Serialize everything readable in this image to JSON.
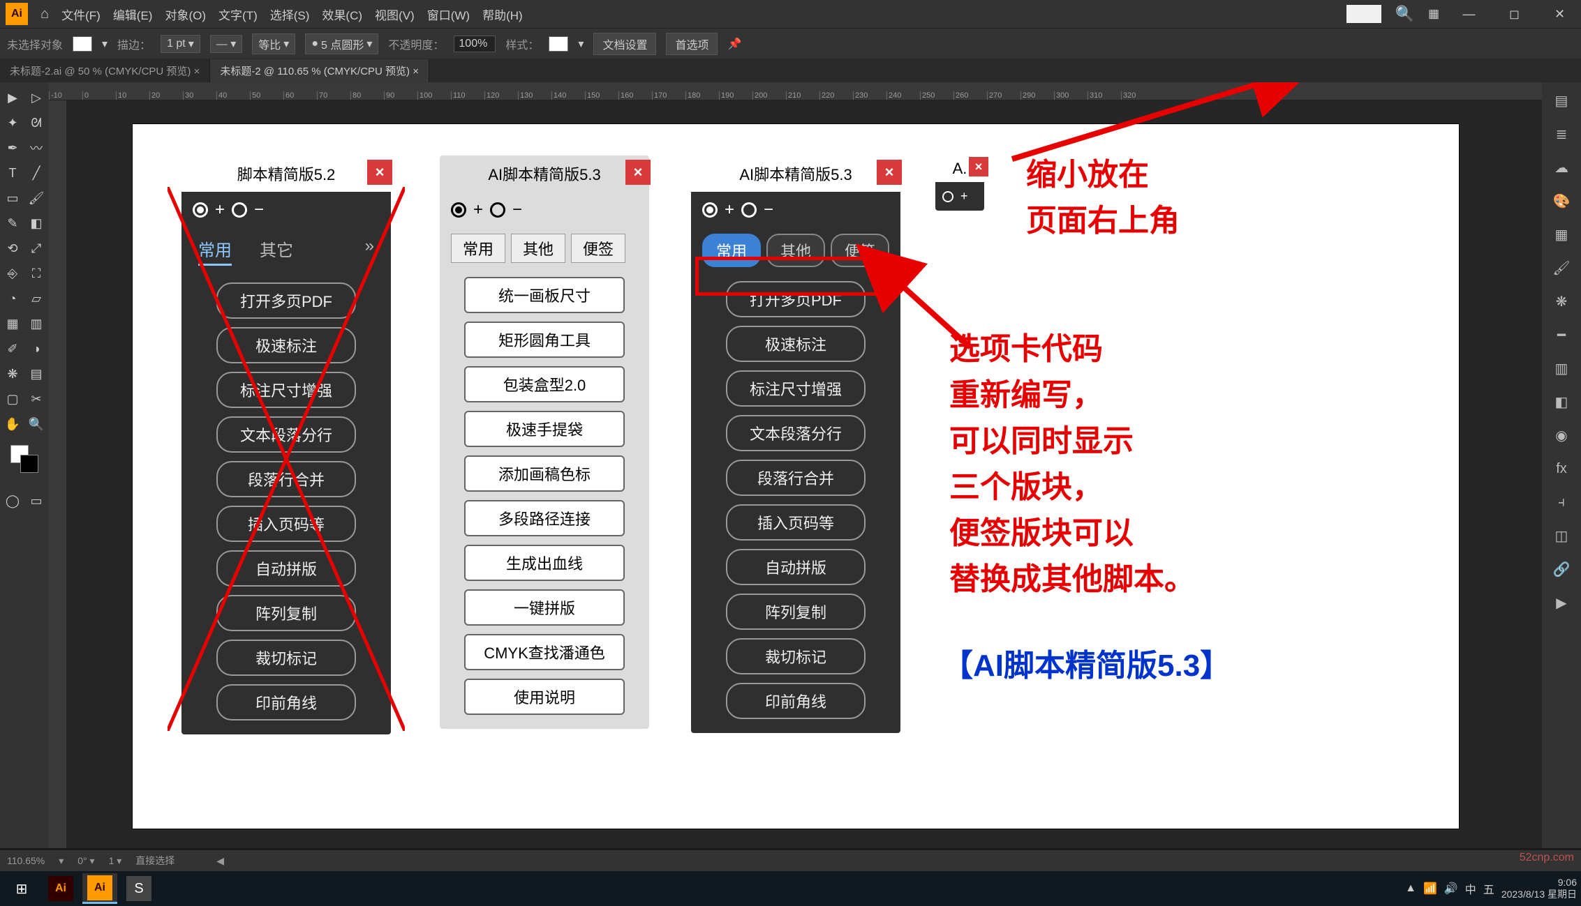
{
  "menubar": {
    "items": [
      "文件(F)",
      "编辑(E)",
      "对象(O)",
      "文字(T)",
      "选择(S)",
      "效果(C)",
      "视图(V)",
      "窗口(W)",
      "帮助(H)"
    ]
  },
  "optionsbar": {
    "selection_label": "未选择对象",
    "stroke_label": "描边：",
    "stroke_width": "1 pt",
    "uniform": "等比",
    "profile": "5 点圆形",
    "opacity_label": "不透明度：",
    "opacity_value": "100%",
    "style_label": "样式：",
    "doc_settings": "文档设置",
    "preferences": "首选项"
  },
  "tabs": {
    "tab1": "未标题-2.ai @ 50 % (CMYK/CPU 预览)",
    "tab2": "未标题-2 @ 110.65 % (CMYK/CPU 预览)"
  },
  "ruler_ticks": [
    "-10",
    "0",
    "10",
    "20",
    "30",
    "40",
    "50",
    "60",
    "70",
    "80",
    "90",
    "100",
    "110",
    "120",
    "130",
    "140",
    "150",
    "160",
    "170",
    "180",
    "190",
    "200",
    "210",
    "220",
    "230",
    "240",
    "250",
    "260",
    "270",
    "290",
    "300",
    "310",
    "320"
  ],
  "panel52": {
    "title": "脚本精简版5.2",
    "tabs": [
      "常用",
      "其它"
    ],
    "buttons": [
      "打开多页PDF",
      "极速标注",
      "标注尺寸增强",
      "文本段落分行",
      "段落行合并",
      "插入页码等",
      "自动拼版",
      "阵列复制",
      "裁切标记",
      "印前角线"
    ]
  },
  "panel53_light": {
    "title": "AI脚本精简版5.3",
    "tabs": [
      "常用",
      "其他",
      "便签"
    ],
    "buttons": [
      "统一画板尺寸",
      "矩形圆角工具",
      "包装盒型2.0",
      "极速手提袋",
      "添加画稿色标",
      "多段路径连接",
      "生成出血线",
      "一键拼版",
      "CMYK查找潘通色",
      "使用说明"
    ]
  },
  "panel53_dark": {
    "title": "AI脚本精简版5.3",
    "tabs": [
      "常用",
      "其他",
      "便签"
    ],
    "buttons": [
      "打开多页PDF",
      "极速标注",
      "标注尺寸增强",
      "文本段落分行",
      "段落行合并",
      "插入页码等",
      "自动拼版",
      "阵列复制",
      "裁切标记",
      "印前角线"
    ]
  },
  "panel_mini": {
    "title": "A."
  },
  "annotations": {
    "topright1": "缩小放在",
    "topright2": "页面右上角",
    "main1": "选项卡代码",
    "main2": "重新编写，",
    "main3": "可以同时显示",
    "main4": "三个版块，",
    "main5": "便签版块可以",
    "main6": "替换成其他脚本。",
    "blue": "【AI脚本精简版5.3】"
  },
  "statusbar": {
    "zoom": "110.65%",
    "tool": "直接选择"
  },
  "taskbar": {
    "time": "9:06",
    "date": "2023/8/13 星期日"
  },
  "watermark": "52cnp.com"
}
